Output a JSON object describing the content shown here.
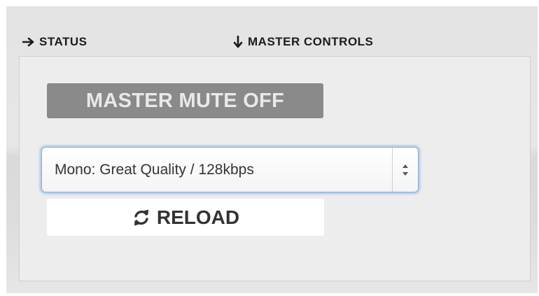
{
  "tabs": {
    "status": {
      "label": "STATUS",
      "icon": "arrow-right-icon"
    },
    "master_controls": {
      "label": "MASTER CONTROLS",
      "icon": "arrow-down-icon"
    }
  },
  "controls": {
    "mute_label": "MASTER MUTE OFF",
    "quality_select": {
      "value": "Mono: Great Quality / 128kbps",
      "icon": "select-arrows-icon"
    },
    "reload_label": "RELOAD",
    "reload_icon": "refresh-icon"
  },
  "colors": {
    "mute_button_bg": "#8a8a8a",
    "select_focus_ring": "#8fb1d6"
  }
}
